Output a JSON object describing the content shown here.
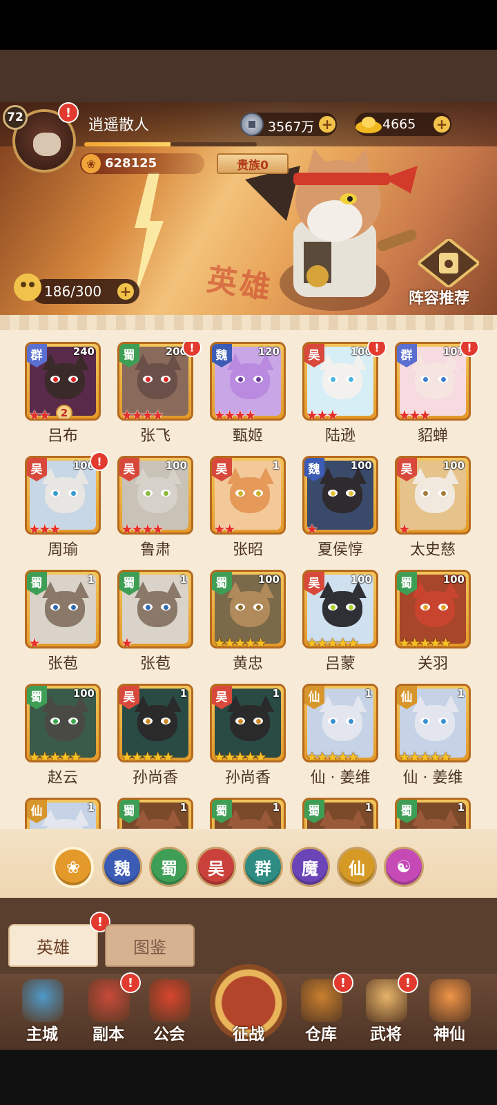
{
  "player": {
    "level": "72",
    "name": "逍遥散人",
    "power": "628125",
    "noble": "贵族0",
    "exp_fraction": 0.5
  },
  "currency": {
    "copper": "3567万",
    "gold": "4665"
  },
  "stamina": "186/300",
  "recommend_label": "阵容推荐",
  "banner_word": "英雄",
  "heroes": [
    {
      "name": "吕布",
      "faction": "群",
      "level": "240",
      "stars": 2,
      "star_color": "red",
      "star_badge": "2",
      "alert": false
    },
    {
      "name": "张飞",
      "faction": "蜀",
      "level": "200",
      "stars": 4,
      "star_color": "red",
      "alert": true
    },
    {
      "name": "甄姬",
      "faction": "魏",
      "level": "120",
      "stars": 4,
      "star_color": "red",
      "alert": false
    },
    {
      "name": "陆逊",
      "faction": "吴",
      "level": "100",
      "stars": 3,
      "star_color": "red",
      "alert": true
    },
    {
      "name": "貂蝉",
      "faction": "群",
      "level": "107",
      "stars": 3,
      "star_color": "red",
      "alert": true
    },
    {
      "name": "周瑜",
      "faction": "吴",
      "level": "100",
      "stars": 3,
      "star_color": "red",
      "alert": true
    },
    {
      "name": "鲁肃",
      "faction": "吴",
      "level": "100",
      "stars": 4,
      "star_color": "red",
      "alert": false
    },
    {
      "name": "张昭",
      "faction": "吴",
      "level": "1",
      "stars": 2,
      "star_color": "red",
      "alert": false
    },
    {
      "name": "夏侯惇",
      "faction": "魏",
      "level": "100",
      "stars": 1,
      "star_color": "red",
      "alert": false
    },
    {
      "name": "太史慈",
      "faction": "吴",
      "level": "100",
      "stars": 1,
      "star_color": "red",
      "alert": false
    },
    {
      "name": "张苞",
      "faction": "蜀",
      "level": "1",
      "stars": 1,
      "star_color": "red",
      "alert": false
    },
    {
      "name": "张苞",
      "faction": "蜀",
      "level": "1",
      "stars": 1,
      "star_color": "red",
      "alert": false
    },
    {
      "name": "黄忠",
      "faction": "蜀",
      "level": "100",
      "stars": 5,
      "star_color": "gold",
      "alert": false
    },
    {
      "name": "吕蒙",
      "faction": "吴",
      "level": "100",
      "stars": 5,
      "star_color": "gold",
      "alert": false
    },
    {
      "name": "关羽",
      "faction": "蜀",
      "level": "100",
      "stars": 5,
      "star_color": "gold",
      "alert": false
    },
    {
      "name": "赵云",
      "faction": "蜀",
      "level": "100",
      "stars": 5,
      "star_color": "gold",
      "alert": false
    },
    {
      "name": "孙尚香",
      "faction": "吴",
      "level": "1",
      "stars": 5,
      "star_color": "gold",
      "alert": false
    },
    {
      "name": "孙尚香",
      "faction": "吴",
      "level": "1",
      "stars": 5,
      "star_color": "gold",
      "alert": false
    },
    {
      "name": "仙 · 姜维",
      "faction": "仙",
      "level": "1",
      "stars": 5,
      "star_color": "gold",
      "alert": false
    },
    {
      "name": "仙 · 姜维",
      "faction": "仙",
      "level": "1",
      "stars": 5,
      "star_color": "gold",
      "alert": false
    },
    {
      "name": "",
      "faction": "仙",
      "level": "1",
      "stars": 0,
      "star_color": "gold",
      "alert": false
    },
    {
      "name": "",
      "faction": "蜀",
      "level": "1",
      "stars": 0,
      "star_color": "gold",
      "alert": false
    },
    {
      "name": "",
      "faction": "蜀",
      "level": "1",
      "stars": 0,
      "star_color": "gold",
      "alert": false
    },
    {
      "name": "",
      "faction": "蜀",
      "level": "1",
      "stars": 0,
      "star_color": "gold",
      "alert": false
    },
    {
      "name": "",
      "faction": "蜀",
      "level": "1",
      "stars": 0,
      "star_color": "gold",
      "alert": false
    }
  ],
  "faction_colors": {
    "群": "#5a6fd0",
    "蜀": "#3f9e55",
    "魏": "#3b5bb5",
    "吴": "#d8493b",
    "仙": "#d7962c"
  },
  "filters": [
    {
      "key": "all",
      "label": "",
      "icon": "paw-icon",
      "color": "#e49a2a"
    },
    {
      "key": "wei",
      "label": "魏",
      "color": "#3b5bb5"
    },
    {
      "key": "shu",
      "label": "蜀",
      "color": "#3f9e55"
    },
    {
      "key": "wu",
      "label": "吴",
      "color": "#c9413a"
    },
    {
      "key": "qun",
      "label": "群",
      "color": "#2f8c83"
    },
    {
      "key": "mo",
      "label": "魔",
      "color": "#6b45b8"
    },
    {
      "key": "xian",
      "label": "仙",
      "color": "#d59a26"
    },
    {
      "key": "special",
      "label": "",
      "icon": "swirl-icon",
      "color": "#c54ab6"
    }
  ],
  "tabs": {
    "heroes": "英雄",
    "codex": "图鉴"
  },
  "nav": [
    {
      "key": "main_city",
      "label": "主城",
      "icon": "castle-icon",
      "color": "#4f9ac9",
      "alert": false
    },
    {
      "key": "dungeon",
      "label": "副本",
      "icon": "sword-icon",
      "color": "#c94a3a",
      "alert": true
    },
    {
      "key": "guild",
      "label": "公会",
      "icon": "flag-icon",
      "color": "#d8452e",
      "alert": false
    },
    {
      "key": "campaign",
      "label": "征战",
      "icon": "campaign-gate-icon",
      "color": "#b2452a",
      "alert": false
    },
    {
      "key": "warehouse",
      "label": "仓库",
      "icon": "bag-icon",
      "color": "#c9802e",
      "alert": true
    },
    {
      "key": "generals",
      "label": "武将",
      "icon": "general-cat-icon",
      "color": "#e7b56a",
      "alert": true
    },
    {
      "key": "immortals",
      "label": "神仙",
      "icon": "cat-icon",
      "color": "#f09448",
      "alert": false
    }
  ]
}
